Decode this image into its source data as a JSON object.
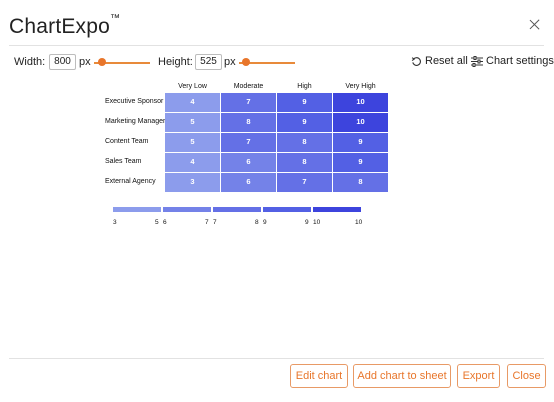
{
  "app": {
    "title": "ChartExpo",
    "trademark": "™"
  },
  "size_controls": {
    "width_label": "Width:",
    "width_value": "800",
    "width_unit": "px",
    "height_label": "Height:",
    "height_value": "525",
    "height_unit": "px"
  },
  "toolbar": {
    "reset_label": "Reset all",
    "settings_label": "Chart settings"
  },
  "chart_data": {
    "type": "heatmap",
    "columns": [
      "Very Low",
      "Moderate",
      "High",
      "Very High"
    ],
    "rows": [
      "Executive Sponsor",
      "Marketing Manager",
      "Content Team",
      "Sales Team",
      "External Agency"
    ],
    "values": [
      [
        4,
        7,
        9,
        10
      ],
      [
        5,
        8,
        9,
        10
      ],
      [
        5,
        7,
        8,
        9
      ],
      [
        4,
        6,
        8,
        9
      ],
      [
        3,
        6,
        7,
        8
      ]
    ],
    "legend": [
      {
        "min": "3",
        "max": "5",
        "color": "#8c9cec"
      },
      {
        "min": "6",
        "max": "7",
        "color": "#7482e8"
      },
      {
        "min": "7",
        "max": "8",
        "color": "#6470e6"
      },
      {
        "min": "9",
        "max": "9",
        "color": "#5360e4"
      },
      {
        "min": "10",
        "max": "10",
        "color": "#3d44dd"
      }
    ]
  },
  "footer": {
    "edit_label": "Edit chart",
    "add_label": "Add chart to sheet",
    "export_label": "Export",
    "close_label": "Close"
  },
  "colors": {
    "accent": "#e8762b"
  }
}
